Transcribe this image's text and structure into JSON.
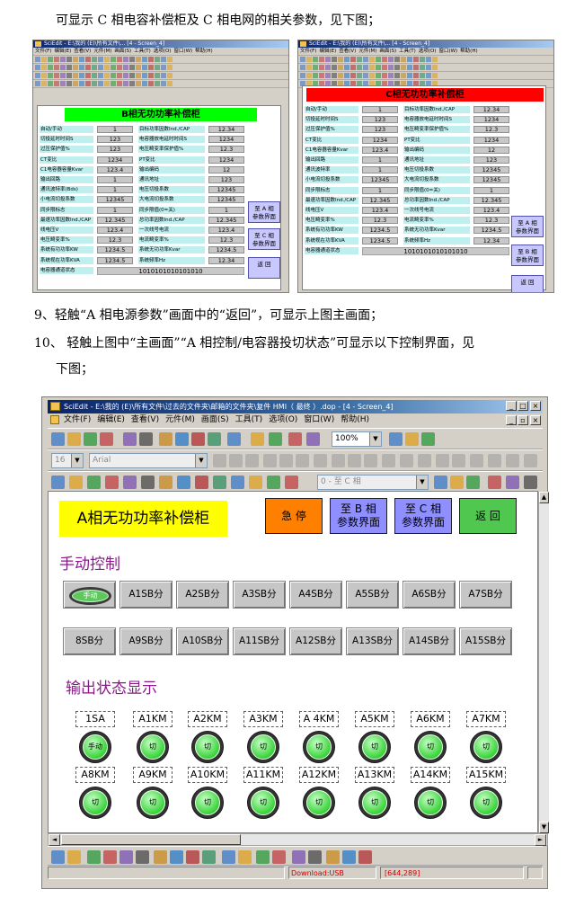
{
  "paragraphs": {
    "intro": "可显示 C 相电容补偿柜及 C 相电网的相关参数，见下图；",
    "step9": "9、轻触“A 相电源参数”画面中的“返回”，可显示上图主画面；",
    "step10_line1": "10、      轻触上图中“主画面”“A 相控制/电容器投切状态”可显示以下控制界面，见",
    "step10_line2": "下图；"
  },
  "left_shot": {
    "header": "B相无功功率补偿柜",
    "header_color": "#00ff00",
    "rows_left": [
      {
        "label": "自动/手动",
        "value": "1"
      },
      {
        "label": "切投延时时间S",
        "value": "123"
      },
      {
        "label": "过压保护值%",
        "value": "123"
      },
      {
        "label": "CT变比",
        "value": "1234"
      },
      {
        "label": "C1电容器容量Kvar",
        "value": "123.4"
      },
      {
        "label": "输出回路",
        "value": "1"
      },
      {
        "label": "通讯波特率(Bds)",
        "value": "1"
      },
      {
        "label": "小电流切投系数",
        "value": "12345"
      },
      {
        "label": "同步限标志",
        "value": "1"
      },
      {
        "label": "最速功率因数Ind./CAP",
        "value": "12.345"
      },
      {
        "label": "线电压V",
        "value": "123.4"
      },
      {
        "label": "电压畸变率%",
        "value": "12.3"
      },
      {
        "label": "系统有功功率KW",
        "value": "1234.5"
      },
      {
        "label": "系统视在功率KVA",
        "value": "1234.5"
      }
    ],
    "rows_right": [
      {
        "label": "目标功率因数Ind./CAP",
        "value": "12.34"
      },
      {
        "label": "电容器放电延时时间S",
        "value": "1234"
      },
      {
        "label": "电压畸变率保护值%",
        "value": "12.3"
      },
      {
        "label": "PT变比",
        "value": "1234"
      },
      {
        "label": "输出编码",
        "value": "12"
      },
      {
        "label": "通讯地址",
        "value": "123"
      },
      {
        "label": "电压切投系数",
        "value": "12345"
      },
      {
        "label": "大电流切投系数",
        "value": "12345"
      },
      {
        "label": "同步限值(0=关)",
        "value": "1"
      },
      {
        "label": "总功率因数Ind./CAP",
        "value": "12.345"
      },
      {
        "label": "一次线号电流",
        "value": "123.4"
      },
      {
        "label": "电流畸变率%",
        "value": "12.3"
      },
      {
        "label": "系统无功功率Kvar",
        "value": "1234.5"
      },
      {
        "label": "系统频率Hz",
        "value": "12.34"
      }
    ],
    "bit_label": "电容器通道状态",
    "bits": "1010101010101010",
    "buttons": [
      "至 A 相\n参数界面",
      "至 C 相\n参数界面",
      "返 回"
    ]
  },
  "right_shot": {
    "header": "C相无功功率补偿柜",
    "header_color": "#ff0000",
    "rows_left": [
      {
        "label": "自动/手动",
        "value": "1"
      },
      {
        "label": "切投延时时间S",
        "value": "123"
      },
      {
        "label": "过压保护值%",
        "value": "123"
      },
      {
        "label": "CT变比",
        "value": "1234"
      },
      {
        "label": "C1电容器容量Kvar",
        "value": "123.4"
      },
      {
        "label": "输出回路",
        "value": "1"
      },
      {
        "label": "通讯波特率",
        "value": "1"
      },
      {
        "label": "小电流切投系数",
        "value": "12345"
      },
      {
        "label": "同步限标志",
        "value": "1"
      },
      {
        "label": "最速功率因数Ind./CAP",
        "value": "12.345"
      },
      {
        "label": "线电压V",
        "value": "123.4"
      },
      {
        "label": "电压畸变率%",
        "value": "12.3"
      },
      {
        "label": "系统有功功率KW",
        "value": "1234.5"
      },
      {
        "label": "系统视在功率KVA",
        "value": "1234.5"
      }
    ],
    "rows_right": [
      {
        "label": "目标功率因数Ind./CAP",
        "value": "12.34"
      },
      {
        "label": "电容器放电延时时间S",
        "value": "1234"
      },
      {
        "label": "电压畸变率保护值%",
        "value": "12.3"
      },
      {
        "label": "PT变比",
        "value": "1234"
      },
      {
        "label": "输出编码",
        "value": "12"
      },
      {
        "label": "通讯地址",
        "value": "123"
      },
      {
        "label": "电压切投系数",
        "value": "12345"
      },
      {
        "label": "大电流切投系数",
        "value": "12345"
      },
      {
        "label": "同步限值(0=关)",
        "value": "1"
      },
      {
        "label": "总功率因数Ind./CAP",
        "value": "12.345"
      },
      {
        "label": "一次线号电流",
        "value": "123.4"
      },
      {
        "label": "电流畸变率%",
        "value": "12.3"
      },
      {
        "label": "系统无功功率Kvar",
        "value": "1234.5"
      },
      {
        "label": "系统频率Hz",
        "value": "12.34"
      }
    ],
    "bit_label": "电容器通道状态",
    "bits": "1010101010101010",
    "buttons": [
      "至 A 相\n参数界面",
      "至 B 相\n参数界面",
      "返 回"
    ]
  },
  "mini_menus": [
    "文件(F)",
    "编辑(E)",
    "查看(V)",
    "元件(M)",
    "画面(S)",
    "工具(T)",
    "选项(O)",
    "窗口(W)",
    "帮助(H)"
  ],
  "mini_title": "SciEdit - E:\\我的 (E)\\所有文件\\... [4 - Screen_4]",
  "main": {
    "window_title": "SciEdit - E:\\我的 (E)\\所有文件\\过去的文件夹\\邮箱的文件夹\\复件 HMI（ 最终 ）.dop - [4 - Screen_4]",
    "menus": [
      "文件(F)",
      "编辑(E)",
      "查看(V)",
      "元件(M)",
      "画面(S)",
      "工具(T)",
      "选项(O)",
      "窗口(W)",
      "帮助(H)"
    ],
    "zoom": "100%",
    "font_size": "16",
    "font_name": "Arial",
    "screen_select": "0 - 至 C 相",
    "screen_title": "A相无功功率补偿柜",
    "buttons": {
      "stop": "急 停",
      "to_b": "至 B 相\n参数界面",
      "to_c": "至 C 相\n参数界面",
      "back": "返 回"
    },
    "manual_section": "手动控制",
    "manual_label": "手动",
    "sb_buttons_row1": [
      "A1SB分",
      "A2SB分",
      "A3SB分",
      "A4SB分",
      "A5SB分",
      "A6SB分",
      "A7SB分"
    ],
    "sb_buttons_row2": [
      "8SB分",
      "A9SB分",
      "A10SB分",
      "A11SB分",
      "A12SB分",
      "A13SB分",
      "A14SB分",
      "A15SB分"
    ],
    "output_section": "输出状态显示",
    "tags_row1": [
      "1SA",
      "A1KM",
      "A2KM",
      "A3KM",
      "A 4KM",
      "A5KM",
      "A6KM",
      "A7KM"
    ],
    "lamps_row1": [
      "手动",
      "切",
      "切",
      "切",
      "切",
      "切",
      "切",
      "切"
    ],
    "tags_row2": [
      "A8KM",
      "A9KM",
      "A10KM",
      "A11KM",
      "A12KM",
      "A13KM",
      "A14KM",
      "A15KM"
    ],
    "lamps_row2": [
      "切",
      "切",
      "切",
      "切",
      "切",
      "切",
      "切",
      "切"
    ],
    "status_download": "Download:USB",
    "status_coords": "[644,289]"
  },
  "colors": {
    "title_yellow": "#ffff00",
    "stop_orange": "#ff7f00",
    "nav_blue": "#8f8fff",
    "back_green": "#50c850",
    "section_purple": "#8a1a8a",
    "lamp_green": "#39d339"
  }
}
